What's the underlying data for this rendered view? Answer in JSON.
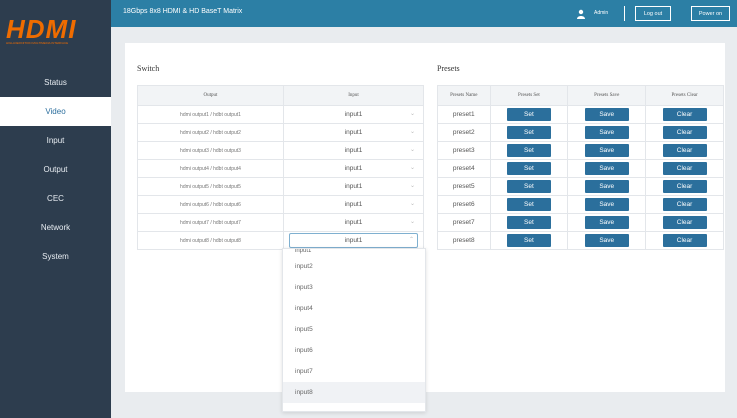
{
  "logo": {
    "text": "HDMI",
    "tagline": "HIGH-DEFINITION MULTIMEDIA INTERFACE"
  },
  "sidebar": {
    "items": [
      {
        "label": "Status"
      },
      {
        "label": "Video"
      },
      {
        "label": "Input"
      },
      {
        "label": "Output"
      },
      {
        "label": "CEC"
      },
      {
        "label": "Network"
      },
      {
        "label": "System"
      }
    ],
    "active": "Video"
  },
  "header": {
    "title": "18Gbps 8x8 HDMI & HD BaseT Matrix",
    "user": "Admin",
    "logout_label": "Log out",
    "power_label": "Power on"
  },
  "switch": {
    "title": "Switch",
    "columns": [
      "Output",
      "Input"
    ],
    "rows": [
      {
        "output": "hdmi output1 / hdbt output1",
        "input": "input1"
      },
      {
        "output": "hdmi output2 / hdbt output2",
        "input": "input1"
      },
      {
        "output": "hdmi output3 / hdbt output3",
        "input": "input1"
      },
      {
        "output": "hdmi output4 / hdbt output4",
        "input": "input1"
      },
      {
        "output": "hdmi output5 / hdbt output5",
        "input": "input1"
      },
      {
        "output": "hdmi output6 / hdbt output6",
        "input": "input1"
      },
      {
        "output": "hdmi output7 / hdbt output7",
        "input": "input1"
      },
      {
        "output": "hdmi output8 / hdbt output8",
        "input": "input1"
      }
    ],
    "dropdown_options": [
      "input1",
      "input2",
      "input3",
      "input4",
      "input5",
      "input6",
      "input7",
      "input8"
    ],
    "open_row": 8,
    "hovered_option": "input8"
  },
  "presets": {
    "title": "Presets",
    "columns": [
      "Presets Name",
      "Presets Set",
      "Presets Save",
      "Presets Clear"
    ],
    "rows": [
      {
        "name": "preset1",
        "set": "Set",
        "save": "Save",
        "clear": "Clear"
      },
      {
        "name": "preset2",
        "set": "Set",
        "save": "Save",
        "clear": "Clear"
      },
      {
        "name": "preset3",
        "set": "Set",
        "save": "Save",
        "clear": "Clear"
      },
      {
        "name": "preset4",
        "set": "Set",
        "save": "Save",
        "clear": "Clear"
      },
      {
        "name": "preset5",
        "set": "Set",
        "save": "Save",
        "clear": "Clear"
      },
      {
        "name": "preset6",
        "set": "Set",
        "save": "Save",
        "clear": "Clear"
      },
      {
        "name": "preset7",
        "set": "Set",
        "save": "Save",
        "clear": "Clear"
      },
      {
        "name": "preset8",
        "set": "Set",
        "save": "Save",
        "clear": "Clear"
      }
    ]
  },
  "icons": {
    "user": "user-icon",
    "caret_down": "chevron-down-icon",
    "caret_up": "chevron-up-icon"
  },
  "colors": {
    "sidebar": "#2d3d4e",
    "topbar": "#2c7fa5",
    "button": "#2b6f9c",
    "logo": "#ef6c00"
  }
}
